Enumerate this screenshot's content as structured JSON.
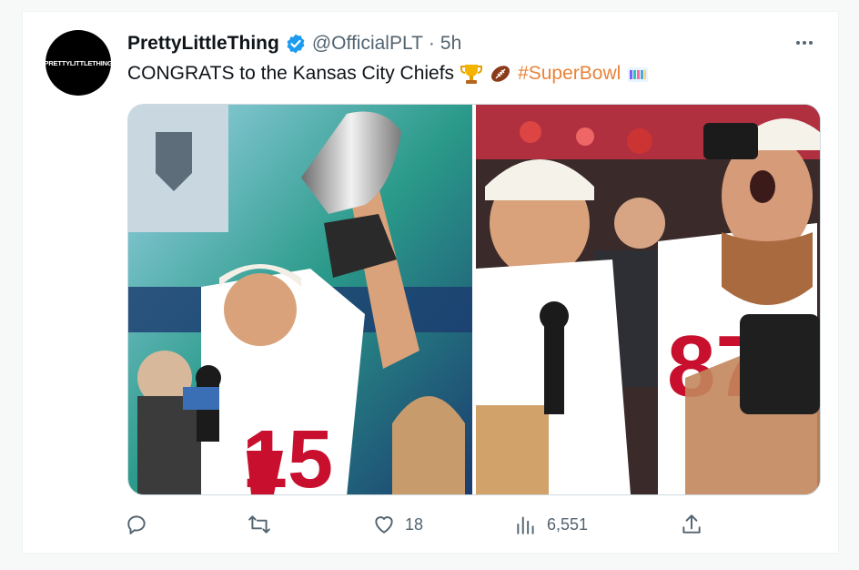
{
  "tweet": {
    "avatar_text": "PRETTYLITTLETHING",
    "display_name": "PrettyLittleThing",
    "handle": "@OfficialPLT",
    "separator": "·",
    "time": "5h",
    "text_main": "CONGRATS to the Kansas City Chiefs",
    "hashtag": "#SuperBowl",
    "emojis": [
      "trophy-emoji",
      "football-emoji",
      "superbowl-logo-emoji"
    ]
  },
  "media": {
    "images": [
      {
        "icon": "photo-trophy-celebration"
      },
      {
        "icon": "photo-players-celebrating"
      }
    ]
  },
  "actions": {
    "reply": {
      "icon": "reply-icon",
      "count": ""
    },
    "retweet": {
      "icon": "retweet-icon",
      "count": ""
    },
    "like": {
      "icon": "like-icon",
      "count": "18"
    },
    "views": {
      "icon": "views-icon",
      "count": "6,551"
    },
    "share": {
      "icon": "share-icon"
    }
  },
  "colors": {
    "accent": "#1d9bf0",
    "hashtag": "#e8833a",
    "muted": "#536471",
    "chiefs_red": "#c8102e"
  }
}
